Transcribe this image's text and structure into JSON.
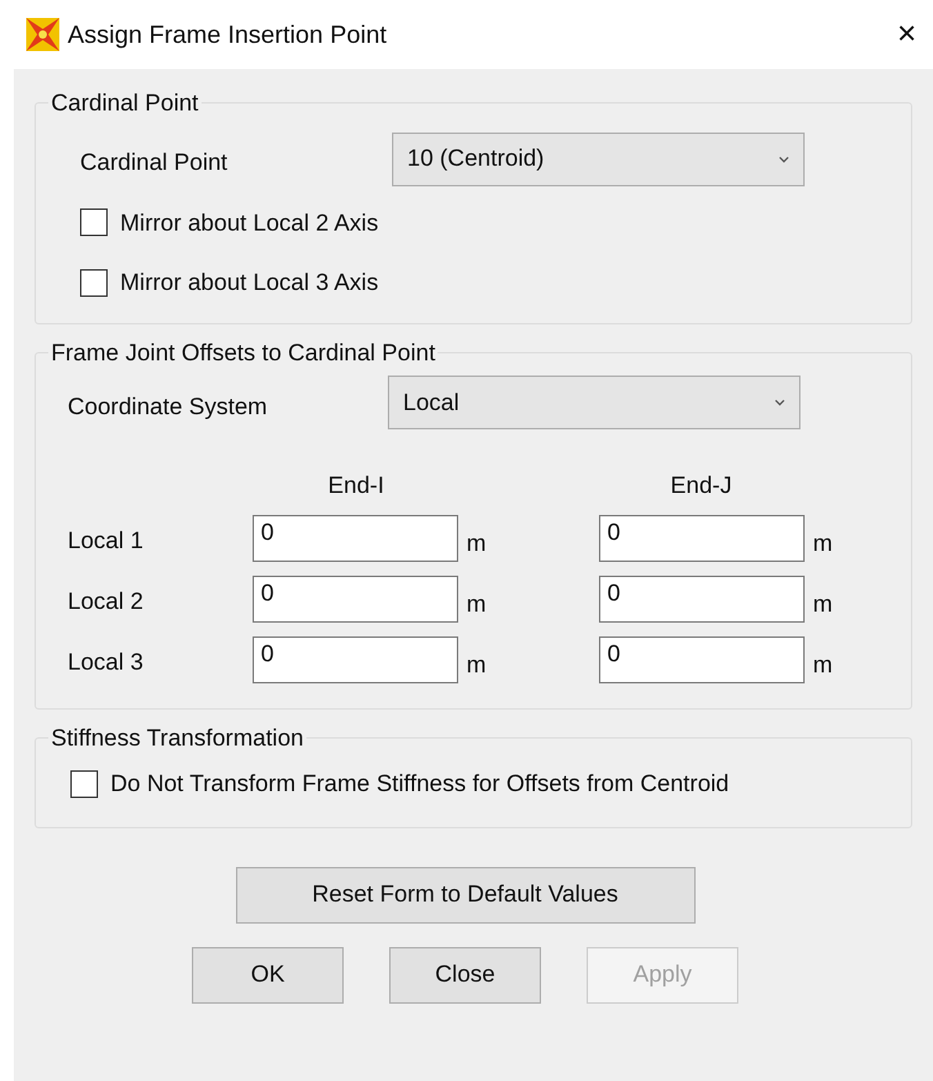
{
  "window": {
    "title": "Assign Frame Insertion Point",
    "close": "×"
  },
  "cardinal": {
    "title": "Cardinal Point",
    "label": "Cardinal Point",
    "value": "10  (Centroid)",
    "checkboxes": [
      {
        "label": "Mirror about Local 2 Axis",
        "checked": false
      },
      {
        "label": "Mirror about Local 3 Axis",
        "checked": false
      }
    ]
  },
  "offsets": {
    "title": "Frame Joint Offsets to Cardinal Point",
    "label": "Coordinate System",
    "value": "Local",
    "columns": [
      "End-I",
      "End-J"
    ],
    "rows": [
      {
        "label": "Local 1",
        "values": [
          "0",
          "0"
        ],
        "units": [
          "m",
          "m"
        ]
      },
      {
        "label": "Local 2",
        "values": [
          "0",
          "0"
        ],
        "units": [
          "m",
          "m"
        ]
      },
      {
        "label": "Local 3",
        "values": [
          "0",
          "0"
        ],
        "units": [
          "m",
          "m"
        ]
      }
    ]
  },
  "stiffness": {
    "title": "Stiffness Transformation",
    "checkboxes": [
      {
        "label": "Do Not Transform Frame Stiffness for Offsets from Centroid",
        "checked": false
      }
    ]
  },
  "reset_button": "Reset Form to Default Values",
  "buttons": [
    {
      "label": "OK",
      "disabled": false
    },
    {
      "label": "Close",
      "disabled": false
    },
    {
      "label": "Apply",
      "disabled": true
    }
  ]
}
